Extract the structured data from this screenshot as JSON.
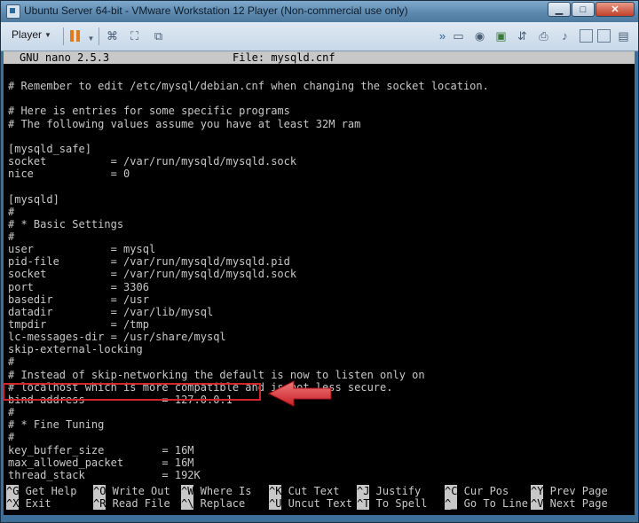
{
  "window": {
    "title": "Ubuntu Server 64-bit - VMware Workstation 12 Player (Non-commercial use only)",
    "buttons": {
      "minimize": "▁",
      "maximize": "□",
      "close": "✕"
    }
  },
  "toolbar": {
    "player_label": "Player",
    "icons": [
      "pause-icon",
      "send-ctrl-alt-del-icon",
      "fullscreen-icon",
      "unity-icon",
      "devices-overflow-icon",
      "hard-disk-icon",
      "cd-dvd-icon",
      "network-adapter-icon",
      "usb-icon",
      "printer-icon",
      "sound-icon",
      "display-icon",
      "storage-icon",
      "message-log-icon"
    ]
  },
  "nano": {
    "version": "GNU nano 2.5.3",
    "file": "File: mysqld.cnf",
    "lines": [
      "",
      "# Remember to edit /etc/mysql/debian.cnf when changing the socket location.",
      "",
      "# Here is entries for some specific programs",
      "# The following values assume you have at least 32M ram",
      "",
      "[mysqld_safe]",
      "socket          = /var/run/mysqld/mysqld.sock",
      "nice            = 0",
      "",
      "[mysqld]",
      "#",
      "# * Basic Settings",
      "#",
      "user            = mysql",
      "pid-file        = /var/run/mysqld/mysqld.pid",
      "socket          = /var/run/mysqld/mysqld.sock",
      "port            = 3306",
      "basedir         = /usr",
      "datadir         = /var/lib/mysql",
      "tmpdir          = /tmp",
      "lc-messages-dir = /usr/share/mysql",
      "skip-external-locking",
      "#",
      "# Instead of skip-networking the default is now to listen only on",
      "# localhost which is more compatible and is not less secure.",
      "bind-address            = 127.0.0.1",
      "#",
      "# * Fine Tuning",
      "#",
      "key_buffer_size         = 16M",
      "max_allowed_packet      = 16M",
      "thread_stack            = 192K"
    ],
    "shortcuts": [
      {
        "key": "^G",
        "label": " Get Help"
      },
      {
        "key": "^O",
        "label": " Write Out"
      },
      {
        "key": "^W",
        "label": " Where Is"
      },
      {
        "key": "^K",
        "label": " Cut Text"
      },
      {
        "key": "^J",
        "label": " Justify"
      },
      {
        "key": "^C",
        "label": " Cur Pos"
      },
      {
        "key": "^Y",
        "label": " Prev Page"
      },
      {
        "key": "^X",
        "label": " Exit"
      },
      {
        "key": "^R",
        "label": " Read File"
      },
      {
        "key": "^\\",
        "label": " Replace"
      },
      {
        "key": "^U",
        "label": " Uncut Text"
      },
      {
        "key": "^T",
        "label": " To Spell"
      },
      {
        "key": "^_",
        "label": " Go To Line"
      },
      {
        "key": "^V",
        "label": " Next Page"
      }
    ]
  },
  "annotation": {
    "highlight_color": "#d3262b",
    "arrow_color": "#d3262b"
  }
}
